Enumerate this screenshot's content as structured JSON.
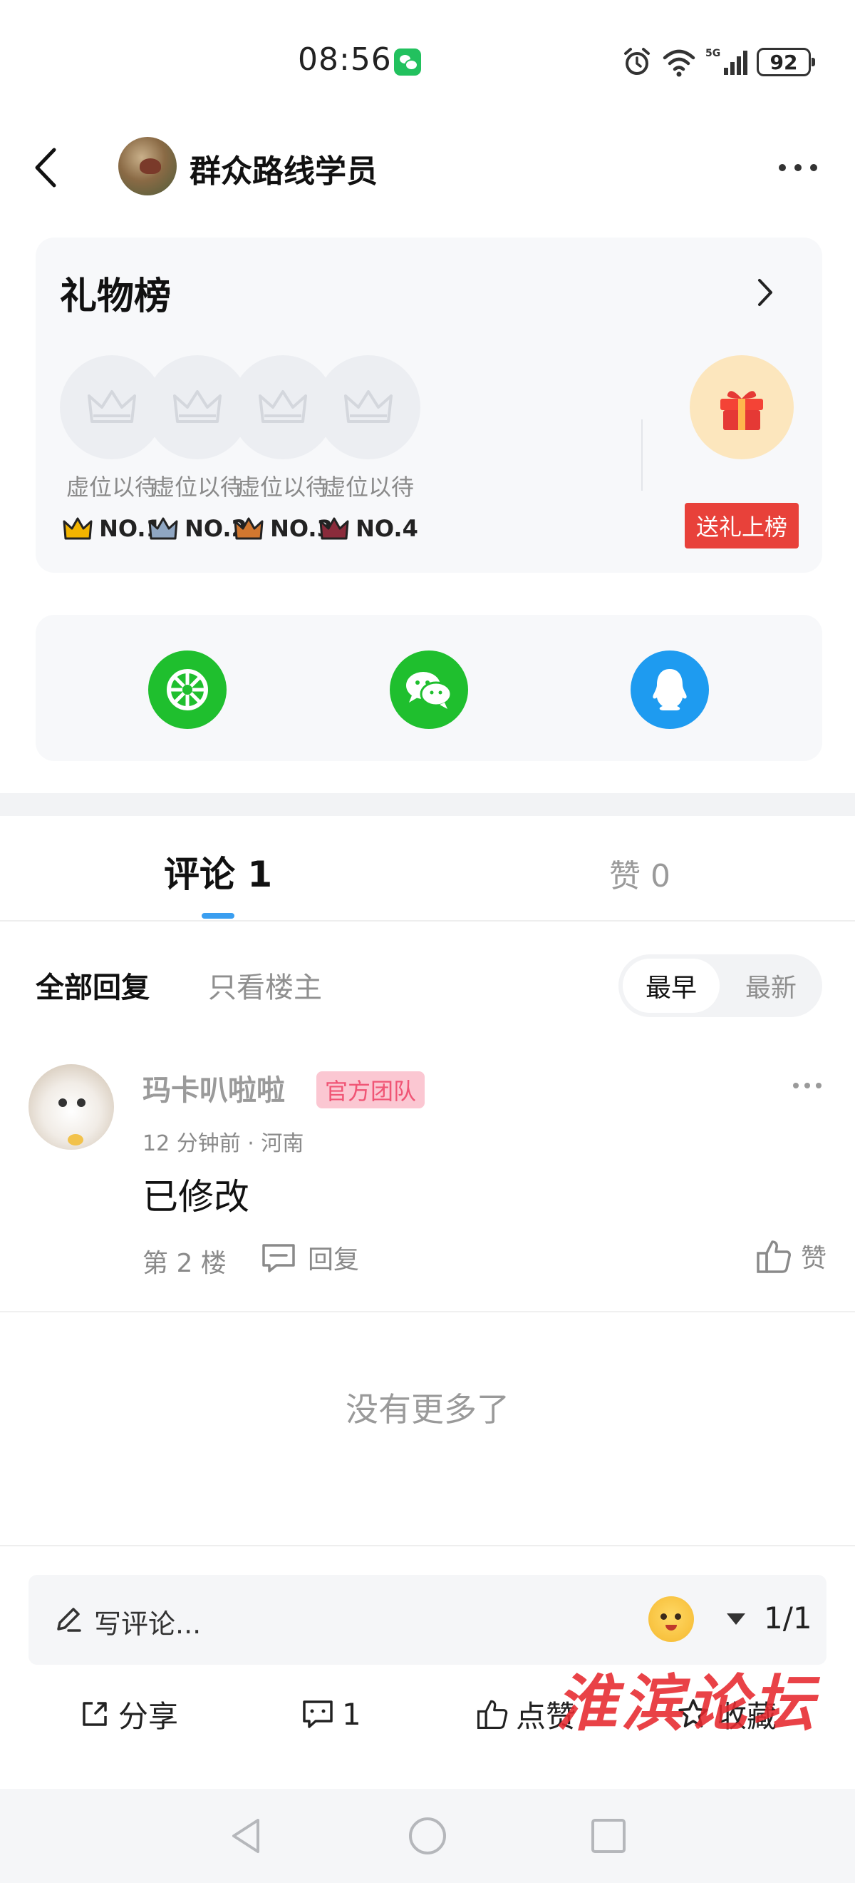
{
  "status_bar": {
    "time": "08:56",
    "battery": "92",
    "icons": [
      "wechat-icon",
      "alarm-icon",
      "wifi-icon",
      "signal-5g-icon",
      "battery-icon"
    ]
  },
  "header": {
    "title": "群众路线学员"
  },
  "gift_board": {
    "title": "礼物榜",
    "slots": [
      {
        "label": "虚位以待",
        "rank": "NO.1",
        "crown_color": "#f2b400"
      },
      {
        "label": "虚位以待",
        "rank": "NO.2",
        "crown_color": "#8fa6c2"
      },
      {
        "label": "虚位以待",
        "rank": "NO.3",
        "crown_color": "#d1772f"
      },
      {
        "label": "虚位以待",
        "rank": "NO.4",
        "crown_color": "#8a2b3b"
      }
    ],
    "send_gift_label": "送礼上榜"
  },
  "share": {
    "icons": [
      "moments-icon",
      "wechat-icon",
      "qq-icon"
    ],
    "colors": {
      "moments": "#1fbf2e",
      "wechat": "#1fbf2e",
      "qq": "#1e9bf0"
    }
  },
  "tabs": {
    "comments_label": "评论 1",
    "likes_label": "赞 0"
  },
  "filter": {
    "all_label": "全部回复",
    "op_label": "只看楼主",
    "sort_earliest": "最早",
    "sort_latest": "最新"
  },
  "comment": {
    "username": "玛卡叭啦啦",
    "badge": "官方团队",
    "meta": "12 分钟前 · 河南",
    "text": "已修改",
    "floor": "第 2 楼",
    "reply_label": "回复",
    "like_label": "赞"
  },
  "no_more": "没有更多了",
  "bottom": {
    "write_placeholder": "写评论...",
    "page": "1/1",
    "share_label": "分享",
    "comment_count": "1",
    "like_label": "点赞",
    "favorite_label": "收藏"
  },
  "watermark": "淮滨论坛",
  "colors": {
    "accent": "#3a9ef0",
    "gift_red": "#e8413a",
    "badge_pink": "#fbc7d2"
  }
}
